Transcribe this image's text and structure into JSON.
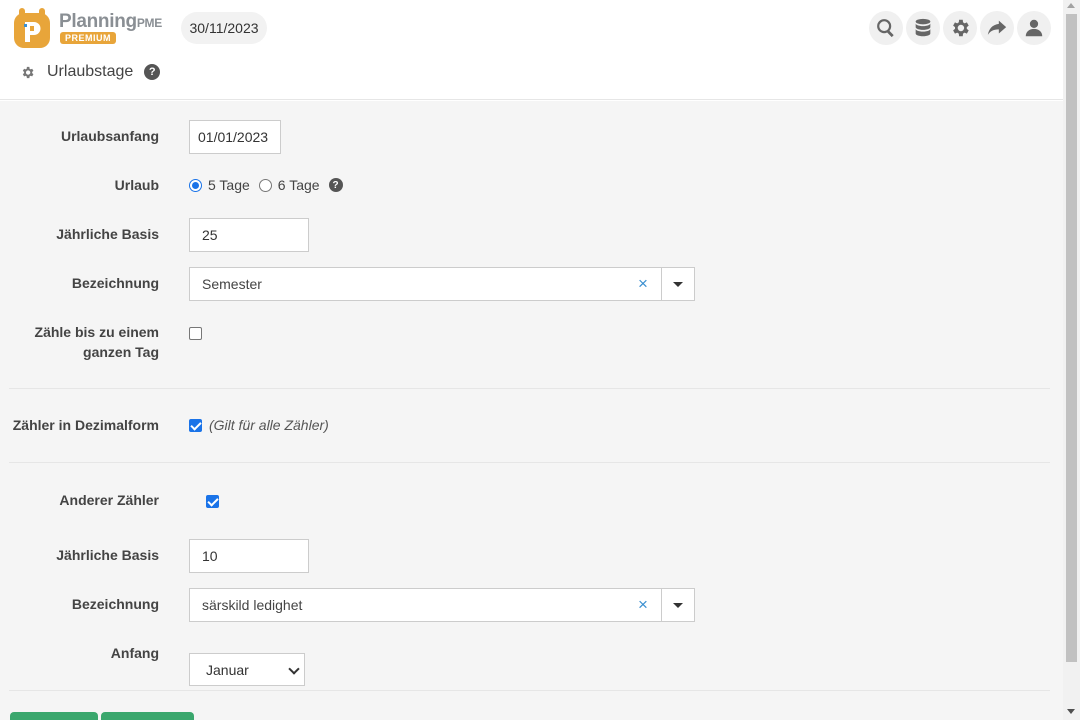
{
  "header": {
    "logo_word": "Planning",
    "logo_word_suffix": "PME",
    "logo_badge": "PREMIUM",
    "date": "30/11/2023",
    "icons": [
      "search-icon",
      "database-icon",
      "gear-icon",
      "share-icon",
      "user-icon"
    ]
  },
  "page": {
    "title": "Urlaubstage",
    "help": "?"
  },
  "form": {
    "start_label": "Urlaubsanfang",
    "start_value": "01/01/2023",
    "vacation_label": "Urlaub",
    "option_5": "5 Tage",
    "option_6": "6 Tage",
    "selected_option": "5 Tage",
    "help": "?",
    "annual_label": "Jährliche Basis",
    "annual_value": "25",
    "designation_label": "Bezeichnung",
    "designation_value": "Semester",
    "clear_symbol": "×",
    "count_full_day_label_1": "Zähle bis zu einem",
    "count_full_day_label_2": "ganzen Tag",
    "count_full_day_checked": false,
    "decimal_label": "Zähler in Dezimalform",
    "decimal_checked": true,
    "decimal_note": "(Gilt für alle Zähler)",
    "other_counter_label": "Anderer Zähler",
    "other_counter_checked": true,
    "annual2_label": "Jährliche Basis",
    "annual2_value": "10",
    "designation2_label": "Bezeichnung",
    "designation2_value": "särskild ledighet",
    "start2_label": "Anfang",
    "start2_value": "Januar"
  },
  "colors": {
    "accent": "#1a73e8",
    "brand_orange": "#e8a53a",
    "button_green": "#3aa76d",
    "clear_blue": "#3a8fd0"
  }
}
